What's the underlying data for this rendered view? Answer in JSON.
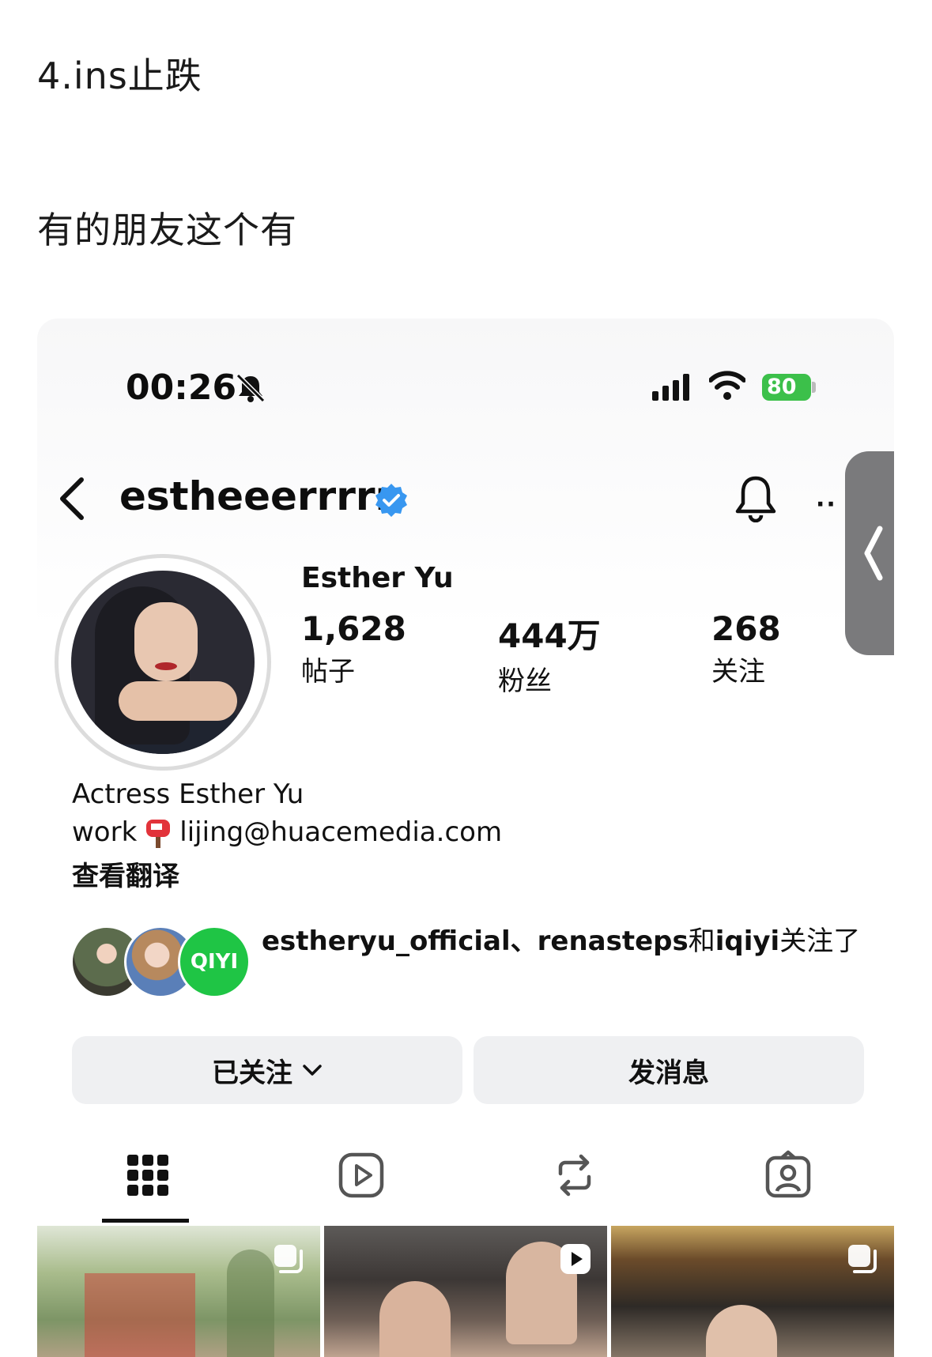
{
  "post": {
    "heading1": "4.ins止跌",
    "heading2": "有的朋友这个有"
  },
  "status_bar": {
    "time": "00:26",
    "battery": "80",
    "icons": [
      "bell-slash-icon",
      "cellular-signal-icon",
      "wifi-icon",
      "battery-icon"
    ]
  },
  "profile_header": {
    "username": "estheeerrrrr",
    "verified": true,
    "icons": [
      "back-chevron-icon",
      "verified-badge-icon",
      "notification-bell-icon",
      "more-dots-icon"
    ]
  },
  "profile": {
    "display_name": "Esther Yu",
    "stats": [
      {
        "value": "1,628",
        "label": "帖子"
      },
      {
        "value": "444万",
        "label": "粉丝"
      },
      {
        "value": "268",
        "label": "关注"
      }
    ],
    "bio_line1": "Actress Esther Yu",
    "bio_line2_prefix": "work",
    "bio_line2_email": "lijing@huacemedia.com",
    "translate_link": "查看翻译",
    "mutual": {
      "names": "estheryu_official、renasteps",
      "connector": "和",
      "last_name": "iqiyi",
      "suffix": "关注了",
      "third_avatar_text": "QIYI"
    }
  },
  "actions": {
    "following_label": "已关注",
    "message_label": "发消息"
  },
  "tabs": [
    "grid-icon",
    "reels-icon",
    "reposts-icon",
    "tagged-icon"
  ],
  "accent": {
    "verified_blue": "#3897f0",
    "battery_green": "#3cc04a",
    "iqiyi_green": "#1fc545"
  }
}
